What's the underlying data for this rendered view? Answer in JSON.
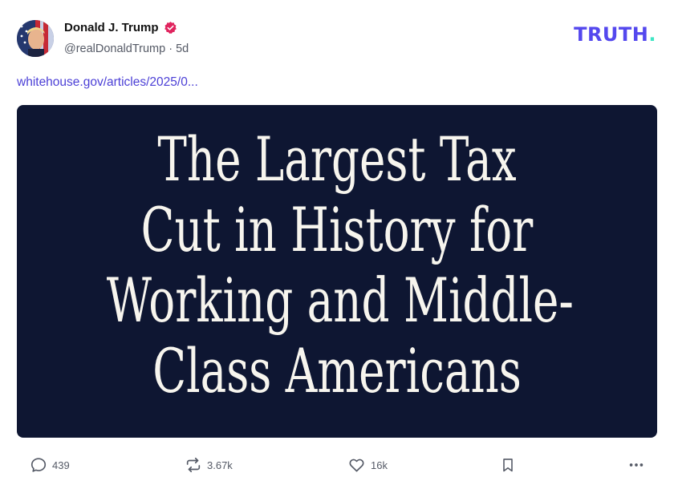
{
  "header": {
    "display_name": "Donald J. Trump",
    "handle": "@realDonaldTrump",
    "separator": "·",
    "time_ago": "5d",
    "brand": "TRUTH",
    "brand_dot": "."
  },
  "post": {
    "link_text": "whitehouse.gov/articles/2025/0...",
    "media_headline": [
      "The Largest Tax",
      "Cut in History for",
      "Working and Middle-",
      "Class Americans"
    ]
  },
  "actions": {
    "replies": "439",
    "retruths": "3.67k",
    "likes": "16k"
  },
  "colors": {
    "brand": "#5448ee",
    "brand_dot": "#3ee6c4",
    "link": "#4b3fd6",
    "media_bg": "#0e1632",
    "verified": "#e0245e"
  },
  "icons": {
    "avatar": "avatar-image",
    "verified": "verified-badge-icon",
    "reply": "speech-bubble-icon",
    "retruth": "repost-arrows-icon",
    "like": "heart-icon",
    "bookmark": "bookmark-icon",
    "more": "ellipsis-icon"
  }
}
